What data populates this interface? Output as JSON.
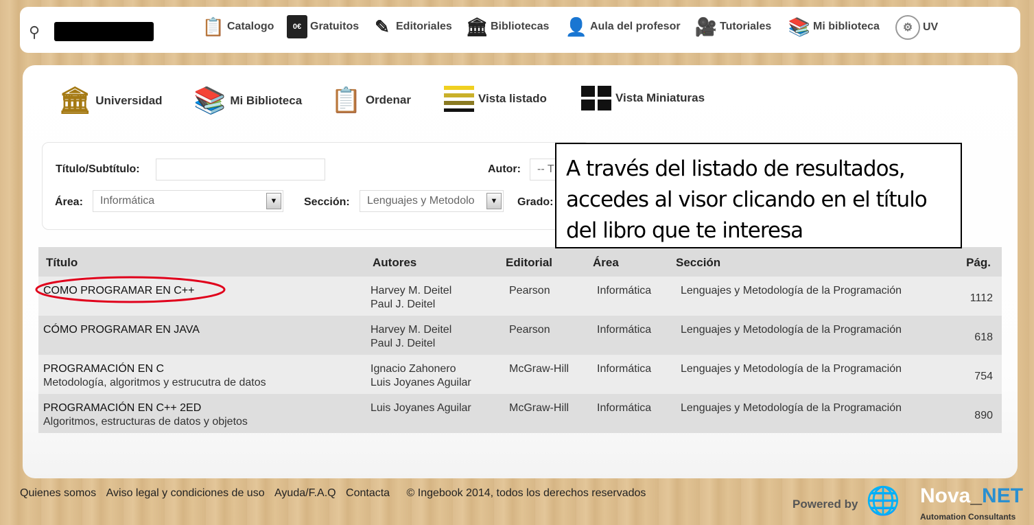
{
  "nav": {
    "items": [
      {
        "label": "Catalogo",
        "icon": "clipboard-icon"
      },
      {
        "label": "Gratuitos",
        "icon": "free-book-icon",
        "badge": "0€"
      },
      {
        "label": "Editoriales",
        "icon": "pen-signature-icon"
      },
      {
        "label": "Bibliotecas",
        "icon": "library-building-icon"
      },
      {
        "label": "Aula del profesor",
        "icon": "teacher-icon"
      },
      {
        "label": "Tutoriales",
        "icon": "video-camera-icon"
      },
      {
        "label": "Mi biblioteca",
        "icon": "book-stack-icon"
      },
      {
        "label": "UV",
        "icon": "university-seal-icon"
      }
    ]
  },
  "toolbar": {
    "items": [
      {
        "label": "Universidad",
        "icon": "university-icon"
      },
      {
        "label": "Mi Biblioteca",
        "icon": "books-icon"
      },
      {
        "label": "Ordenar",
        "icon": "sort-clipboard-icon"
      },
      {
        "label": "Vista listado",
        "icon": "list-view-icon"
      },
      {
        "label": "Vista Miniaturas",
        "icon": "grid-view-icon"
      }
    ]
  },
  "filters": {
    "title_label": "Título/Subtítulo:",
    "title_value": "",
    "author_label": "Autor:",
    "author_value": "-- T",
    "area_label": "Área:",
    "area_value": "Informática",
    "section_label": "Sección:",
    "section_value": "Lenguajes y Metodolo",
    "grade_label": "Grado:"
  },
  "table": {
    "headers": {
      "title": "Título",
      "authors": "Autores",
      "publisher": "Editorial",
      "area": "Área",
      "section": "Sección",
      "pages": "Pág."
    },
    "rows": [
      {
        "title": "COMO PROGRAMAR EN C++",
        "subtitle": "",
        "author1": "Harvey M. Deitel",
        "author2": "Paul J. Deitel",
        "publisher": "Pearson",
        "area": "Informática",
        "section": "Lenguajes y Metodología de la Programación",
        "pages": "1112"
      },
      {
        "title": "CÓMO PROGRAMAR EN JAVA",
        "subtitle": "",
        "author1": "Harvey M. Deitel",
        "author2": "Paul J. Deitel",
        "publisher": "Pearson",
        "area": "Informática",
        "section": "Lenguajes y Metodología de la Programación",
        "pages": "618"
      },
      {
        "title": "PROGRAMACIÓN EN C",
        "subtitle": "Metodología, algoritmos y estrucutra de datos",
        "author1": "Ignacio Zahonero",
        "author2": "Luis Joyanes Aguilar",
        "publisher": "McGraw-Hill",
        "area": "Informática",
        "section": "Lenguajes y Metodología de la Programación",
        "pages": "754"
      },
      {
        "title": "PROGRAMACIÓN EN C++ 2ED",
        "subtitle": "Algoritmos, estructuras de datos y objetos",
        "author1": "Luis Joyanes Aguilar",
        "author2": "",
        "publisher": "McGraw-Hill",
        "area": "Informática",
        "section": "Lenguajes y Metodología de la Programación",
        "pages": "890"
      }
    ]
  },
  "callout": {
    "text": "A través del listado de resultados, accedes al visor clicando en el título del libro que te interesa",
    "highlight_color": "#e0001b"
  },
  "footer": {
    "links": [
      "Quienes somos",
      "Aviso legal y condiciones de uso",
      "Ayuda/F.A.Q",
      "Contacta"
    ],
    "copyright": "© Ingebook 2014, todos los derechos reservados",
    "powered_by": "Powered by",
    "brand_nova": "Nova",
    "brand_net": "NET",
    "brand_tagline": "Automation Consultants"
  }
}
